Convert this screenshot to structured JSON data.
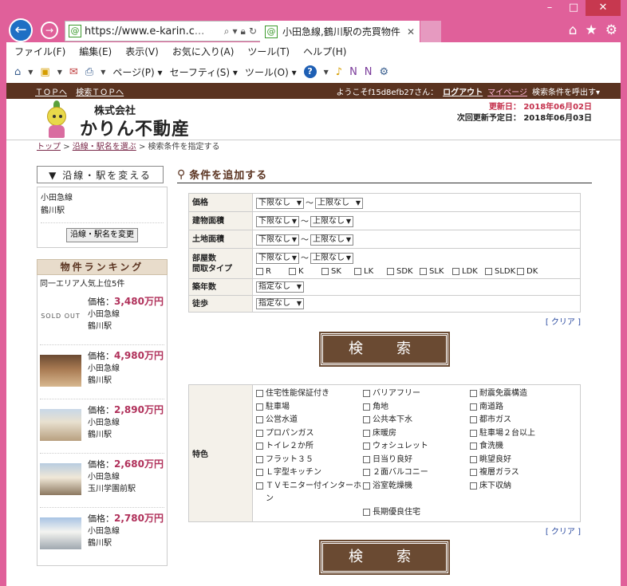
{
  "browser": {
    "url_host": "https://www.e-karin.c",
    "url_rest": "...",
    "tab_title": "小田急線,鶴川駅の売買物件",
    "menu": [
      "ファイル(F)",
      "編集(E)",
      "表示(V)",
      "お気に入り(A)",
      "ツール(T)",
      "ヘルプ(H)"
    ],
    "toolbar": {
      "page": "ページ(P)",
      "safety": "セーフティ(S)",
      "tools": "ツール(O)"
    },
    "win_controls": [
      "–",
      "□",
      "✕"
    ]
  },
  "site": {
    "top_link": "ＴＯＰへ",
    "search_top_link": "検索ＴＯＰへ",
    "welcome": "ようこそf15d8efb27さん：",
    "logout": "ログアウト",
    "mypage": "マイページ",
    "saved_search": "検索条件を呼出す▾",
    "company_prefix": "株式会社",
    "company_name": "かりん不動産",
    "updated_label": "更新日：",
    "updated_date": "2018年06月02日",
    "next_update_label": "次回更新予定日：",
    "next_update_date": "2018年06月03日"
  },
  "breadcrumb": {
    "home": "トップ",
    "line": "沿線・駅名を選ぶ",
    "sep": ">",
    "current": "検索条件を指定する"
  },
  "sidebar": {
    "change_header": "▼ 沿線・駅を変える",
    "line": "小田急線",
    "station": "鶴川駅",
    "change_button": "沿線・駅名を変更",
    "ranking_header": "物件ランキング",
    "ranking_sub": "同一エリア人気上位5件",
    "price_label": "価格：",
    "items": [
      {
        "thumb": "SOLD OUT",
        "price": "3,480万円",
        "line": "小田急線",
        "station": "鶴川駅"
      },
      {
        "thumb": "",
        "price": "4,980万円",
        "line": "小田急線",
        "station": "鶴川駅"
      },
      {
        "thumb": "",
        "price": "2,890万円",
        "line": "小田急線",
        "station": "鶴川駅"
      },
      {
        "thumb": "",
        "price": "2,680万円",
        "line": "小田急線",
        "station": "玉川学園前駅"
      },
      {
        "thumb": "",
        "price": "2,780万円",
        "line": "小田急線",
        "station": "鶴川駅"
      }
    ]
  },
  "main": {
    "title": "条件を追加する",
    "conditions": {
      "price_label": "価格",
      "building_area_label": "建物面積",
      "land_area_label": "土地面積",
      "rooms_label_1": "部屋数",
      "rooms_label_2": "間取タイプ",
      "age_label": "築年数",
      "walk_label": "徒歩",
      "lower": "下限なし",
      "upper": "上限なし",
      "unspecified": "指定なし",
      "tilde": "～",
      "layouts": [
        "R",
        "K",
        "SK",
        "LK",
        "SDK",
        "SLK",
        "LDK",
        "SLDK",
        "DK"
      ]
    },
    "clear": "[ クリア ]",
    "search_button": "検　索",
    "features_label": "特色",
    "features": [
      "住宅性能保証付き",
      "バリアフリー",
      "耐震免震構造",
      "駐車場",
      "角地",
      "南道路",
      "公営水道",
      "公共本下水",
      "都市ガス",
      "プロパンガス",
      "床暖房",
      "駐車場２台以上",
      "トイレ２か所",
      "ウォシュレット",
      "食洗機",
      "フラット３５",
      "日当り良好",
      "眺望良好",
      "Ｌ字型キッチン",
      "２面バルコニー",
      "複層ガラス",
      "ＴＶモニター付インターホン",
      "浴室乾燥機",
      "床下収納",
      "",
      "長期優良住宅",
      ""
    ]
  }
}
